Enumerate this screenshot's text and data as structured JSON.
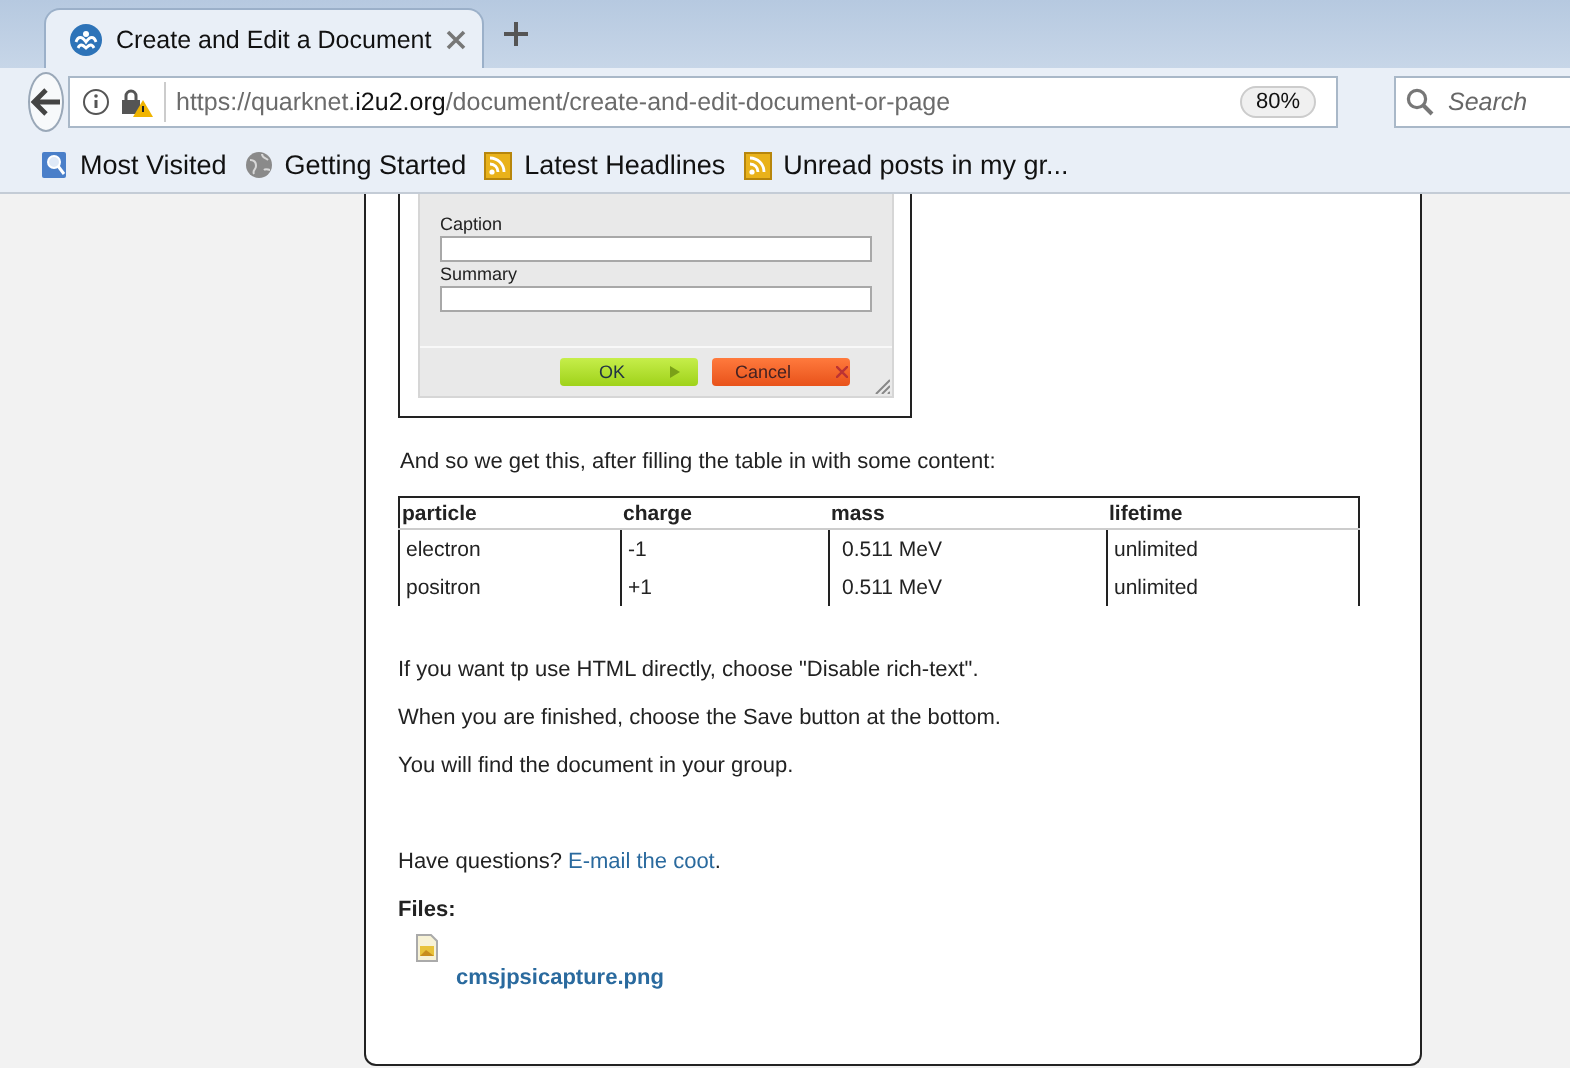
{
  "tab": {
    "title": "Create and Edit a Document",
    "selected": true
  },
  "nav": {
    "url_parts": [
      {
        "text": "https://quarknet.",
        "strong": false
      },
      {
        "text": "i2u2.org",
        "strong": true
      },
      {
        "text": "/document/create-and-edit-document-or-page",
        "strong": false
      }
    ],
    "zoom": "80%",
    "search": {
      "placeholder": "Search"
    }
  },
  "bookmarks": [
    {
      "label": "Most Visited",
      "kind": "folder"
    },
    {
      "label": "Getting Started",
      "kind": "globe"
    },
    {
      "label": "Latest Headlines",
      "kind": "feed"
    },
    {
      "label": "Unread posts in my gr...",
      "kind": "feed"
    }
  ],
  "dialog": {
    "fields": [
      "Caption",
      "Summary"
    ],
    "buttons": [
      {
        "label": "OK",
        "kind": "ok"
      },
      {
        "label": "Cancel",
        "kind": "cancel"
      }
    ]
  },
  "intro": "And so we get this, after filling the table in with some content:",
  "table": {
    "columns": [
      "particle",
      "charge",
      "mass",
      "lifetime"
    ],
    "rows": [
      [
        "electron",
        "-1",
        "0.511 MeV",
        "unlimited"
      ],
      [
        "positron",
        "+1",
        "0.511 MeV",
        "unlimited"
      ]
    ]
  },
  "paragraphs": [
    "If you want tp use HTML directly, choose \"Disable rich-text\".",
    "When you are finished, choose the Save button at the bottom.",
    "You will find the document in your group."
  ],
  "contact": {
    "text": "Have questions?",
    "link": "E-mail the coot",
    "end": "."
  },
  "files": {
    "heading": "Files:",
    "items": [
      "cmsjpsicapture.png"
    ]
  }
}
